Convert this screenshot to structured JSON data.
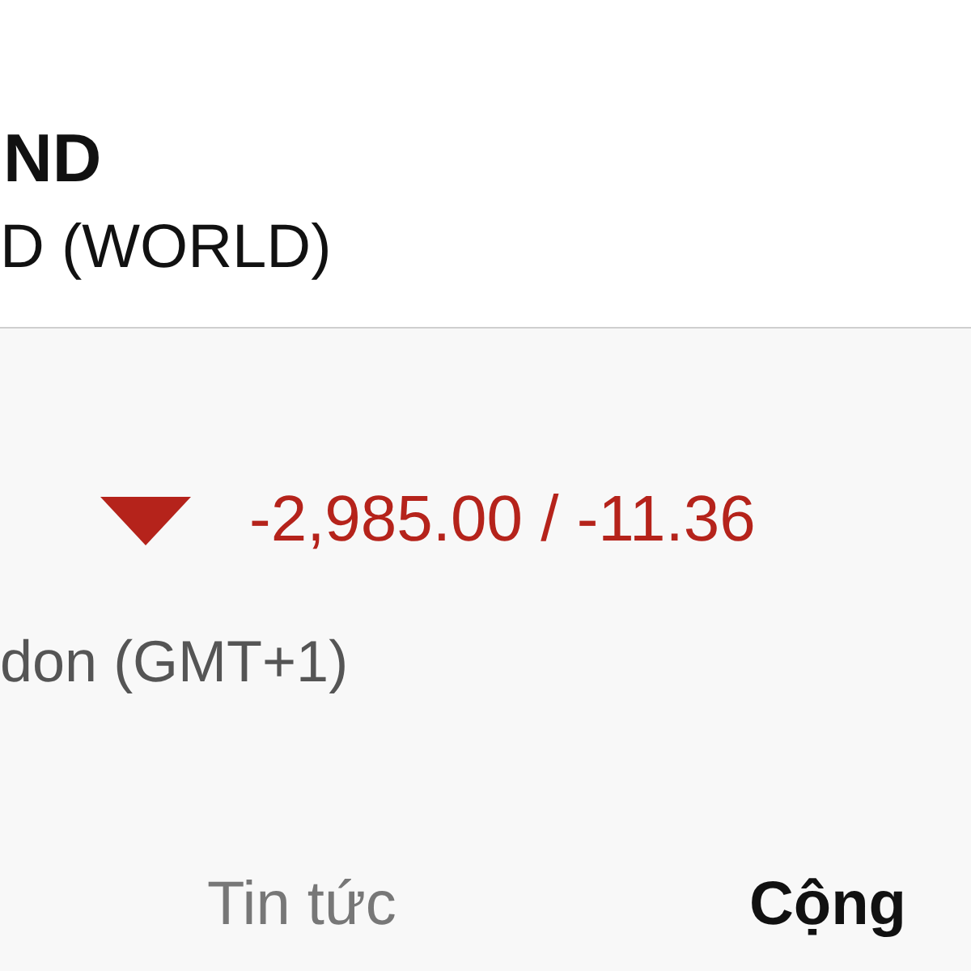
{
  "header": {
    "title": "ND",
    "subtitle": "D (WORLD)"
  },
  "quote": {
    "falling": true,
    "change": "-2,985.00 / -11.36",
    "timezone": "don (GMT+1)"
  },
  "tabs": [
    {
      "label": "Tin tức",
      "selected": false
    },
    {
      "label": "Cộng",
      "selected": true
    }
  ]
}
